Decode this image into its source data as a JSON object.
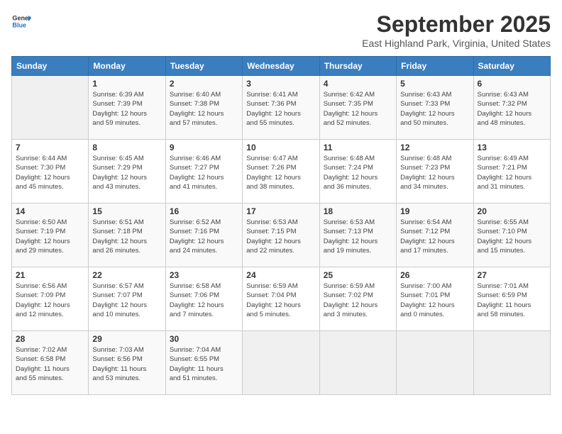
{
  "logo": {
    "line1": "General",
    "line2": "Blue"
  },
  "title": "September 2025",
  "subtitle": "East Highland Park, Virginia, United States",
  "weekdays": [
    "Sunday",
    "Monday",
    "Tuesday",
    "Wednesday",
    "Thursday",
    "Friday",
    "Saturday"
  ],
  "weeks": [
    [
      {
        "day": "",
        "info": ""
      },
      {
        "day": "1",
        "info": "Sunrise: 6:39 AM\nSunset: 7:39 PM\nDaylight: 12 hours\nand 59 minutes."
      },
      {
        "day": "2",
        "info": "Sunrise: 6:40 AM\nSunset: 7:38 PM\nDaylight: 12 hours\nand 57 minutes."
      },
      {
        "day": "3",
        "info": "Sunrise: 6:41 AM\nSunset: 7:36 PM\nDaylight: 12 hours\nand 55 minutes."
      },
      {
        "day": "4",
        "info": "Sunrise: 6:42 AM\nSunset: 7:35 PM\nDaylight: 12 hours\nand 52 minutes."
      },
      {
        "day": "5",
        "info": "Sunrise: 6:43 AM\nSunset: 7:33 PM\nDaylight: 12 hours\nand 50 minutes."
      },
      {
        "day": "6",
        "info": "Sunrise: 6:43 AM\nSunset: 7:32 PM\nDaylight: 12 hours\nand 48 minutes."
      }
    ],
    [
      {
        "day": "7",
        "info": "Sunrise: 6:44 AM\nSunset: 7:30 PM\nDaylight: 12 hours\nand 45 minutes."
      },
      {
        "day": "8",
        "info": "Sunrise: 6:45 AM\nSunset: 7:29 PM\nDaylight: 12 hours\nand 43 minutes."
      },
      {
        "day": "9",
        "info": "Sunrise: 6:46 AM\nSunset: 7:27 PM\nDaylight: 12 hours\nand 41 minutes."
      },
      {
        "day": "10",
        "info": "Sunrise: 6:47 AM\nSunset: 7:26 PM\nDaylight: 12 hours\nand 38 minutes."
      },
      {
        "day": "11",
        "info": "Sunrise: 6:48 AM\nSunset: 7:24 PM\nDaylight: 12 hours\nand 36 minutes."
      },
      {
        "day": "12",
        "info": "Sunrise: 6:48 AM\nSunset: 7:23 PM\nDaylight: 12 hours\nand 34 minutes."
      },
      {
        "day": "13",
        "info": "Sunrise: 6:49 AM\nSunset: 7:21 PM\nDaylight: 12 hours\nand 31 minutes."
      }
    ],
    [
      {
        "day": "14",
        "info": "Sunrise: 6:50 AM\nSunset: 7:19 PM\nDaylight: 12 hours\nand 29 minutes."
      },
      {
        "day": "15",
        "info": "Sunrise: 6:51 AM\nSunset: 7:18 PM\nDaylight: 12 hours\nand 26 minutes."
      },
      {
        "day": "16",
        "info": "Sunrise: 6:52 AM\nSunset: 7:16 PM\nDaylight: 12 hours\nand 24 minutes."
      },
      {
        "day": "17",
        "info": "Sunrise: 6:53 AM\nSunset: 7:15 PM\nDaylight: 12 hours\nand 22 minutes."
      },
      {
        "day": "18",
        "info": "Sunrise: 6:53 AM\nSunset: 7:13 PM\nDaylight: 12 hours\nand 19 minutes."
      },
      {
        "day": "19",
        "info": "Sunrise: 6:54 AM\nSunset: 7:12 PM\nDaylight: 12 hours\nand 17 minutes."
      },
      {
        "day": "20",
        "info": "Sunrise: 6:55 AM\nSunset: 7:10 PM\nDaylight: 12 hours\nand 15 minutes."
      }
    ],
    [
      {
        "day": "21",
        "info": "Sunrise: 6:56 AM\nSunset: 7:09 PM\nDaylight: 12 hours\nand 12 minutes."
      },
      {
        "day": "22",
        "info": "Sunrise: 6:57 AM\nSunset: 7:07 PM\nDaylight: 12 hours\nand 10 minutes."
      },
      {
        "day": "23",
        "info": "Sunrise: 6:58 AM\nSunset: 7:06 PM\nDaylight: 12 hours\nand 7 minutes."
      },
      {
        "day": "24",
        "info": "Sunrise: 6:59 AM\nSunset: 7:04 PM\nDaylight: 12 hours\nand 5 minutes."
      },
      {
        "day": "25",
        "info": "Sunrise: 6:59 AM\nSunset: 7:02 PM\nDaylight: 12 hours\nand 3 minutes."
      },
      {
        "day": "26",
        "info": "Sunrise: 7:00 AM\nSunset: 7:01 PM\nDaylight: 12 hours\nand 0 minutes."
      },
      {
        "day": "27",
        "info": "Sunrise: 7:01 AM\nSunset: 6:59 PM\nDaylight: 11 hours\nand 58 minutes."
      }
    ],
    [
      {
        "day": "28",
        "info": "Sunrise: 7:02 AM\nSunset: 6:58 PM\nDaylight: 11 hours\nand 55 minutes."
      },
      {
        "day": "29",
        "info": "Sunrise: 7:03 AM\nSunset: 6:56 PM\nDaylight: 11 hours\nand 53 minutes."
      },
      {
        "day": "30",
        "info": "Sunrise: 7:04 AM\nSunset: 6:55 PM\nDaylight: 11 hours\nand 51 minutes."
      },
      {
        "day": "",
        "info": ""
      },
      {
        "day": "",
        "info": ""
      },
      {
        "day": "",
        "info": ""
      },
      {
        "day": "",
        "info": ""
      }
    ]
  ]
}
